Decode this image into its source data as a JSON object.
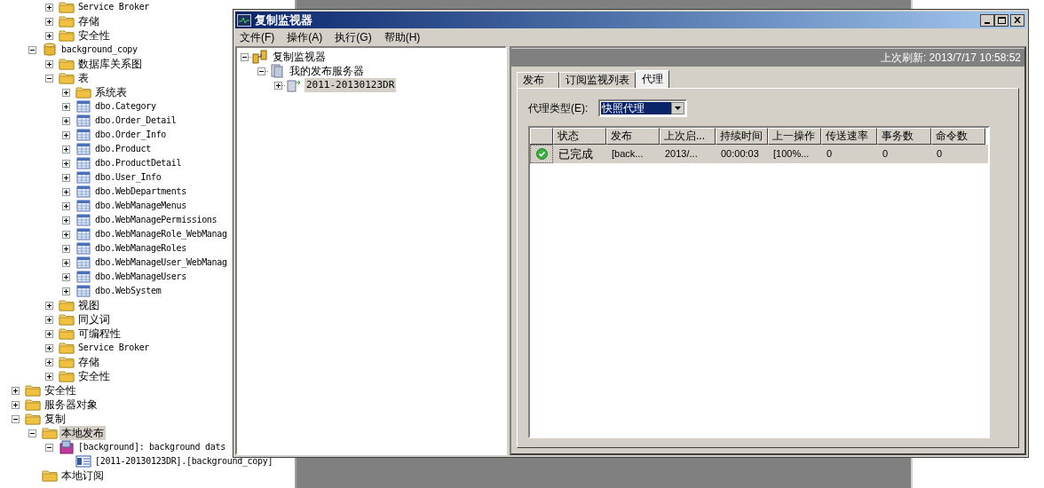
{
  "object_explorer": {
    "continued_items": [
      {
        "label": "Service Broker",
        "kind": "folder",
        "expandable": true,
        "expanded": false,
        "selected": false
      },
      {
        "label": "存储",
        "kind": "folder",
        "expandable": true,
        "expanded": false,
        "selected": false
      },
      {
        "label": "安全性",
        "kind": "folder",
        "expandable": true,
        "expanded": false,
        "selected": false
      }
    ],
    "database_items": [
      {
        "label": "background_copy",
        "kind": "database",
        "expanded": true,
        "selected": false,
        "children": [
          {
            "label": "数据库关系图",
            "kind": "folder",
            "expandable": true,
            "expanded": false,
            "selected": false
          },
          {
            "label": "表",
            "kind": "folder",
            "expanded": true,
            "selected": false,
            "children": [
              {
                "label": "系统表",
                "kind": "folder",
                "expandable": true,
                "expanded": false,
                "selected": false
              },
              {
                "label": "dbo.Category",
                "kind": "table",
                "expandable": true,
                "expanded": false,
                "selected": false
              },
              {
                "label": "dbo.Order_Detail",
                "kind": "table",
                "expandable": true,
                "expanded": false,
                "selected": false
              },
              {
                "label": "dbo.Order_Info",
                "kind": "table",
                "expandable": true,
                "expanded": false,
                "selected": false
              },
              {
                "label": "dbo.Product",
                "kind": "table",
                "expandable": true,
                "expanded": false,
                "selected": false
              },
              {
                "label": "dbo.ProductDetail",
                "kind": "table",
                "expandable": true,
                "expanded": false,
                "selected": false
              },
              {
                "label": "dbo.User_Info",
                "kind": "table",
                "expandable": true,
                "expanded": false,
                "selected": false
              },
              {
                "label": "dbo.WebDepartments",
                "kind": "table",
                "expandable": true,
                "expanded": false,
                "selected": false
              },
              {
                "label": "dbo.WebManageMenus",
                "kind": "table",
                "expandable": true,
                "expanded": false,
                "selected": false
              },
              {
                "label": "dbo.WebManagePermissions",
                "kind": "table",
                "expandable": true,
                "expanded": false,
                "selected": false
              },
              {
                "label": "dbo.WebManageRole_WebManag",
                "kind": "table",
                "expandable": true,
                "expanded": false,
                "selected": false
              },
              {
                "label": "dbo.WebManageRoles",
                "kind": "table",
                "expandable": true,
                "expanded": false,
                "selected": false
              },
              {
                "label": "dbo.WebManageUser_WebManag",
                "kind": "table",
                "expandable": true,
                "expanded": false,
                "selected": false
              },
              {
                "label": "dbo.WebManageUsers",
                "kind": "table",
                "expandable": true,
                "expanded": false,
                "selected": false
              },
              {
                "label": "dbo.WebSystem",
                "kind": "table",
                "expandable": true,
                "expanded": false,
                "selected": false
              }
            ]
          },
          {
            "label": "视图",
            "kind": "folder",
            "expandable": true,
            "expanded": false,
            "selected": false
          },
          {
            "label": "同义词",
            "kind": "folder",
            "expandable": true,
            "expanded": false,
            "selected": false
          },
          {
            "label": "可编程性",
            "kind": "folder",
            "expandable": true,
            "expanded": false,
            "selected": false
          },
          {
            "label": "Service Broker",
            "kind": "folder",
            "expandable": true,
            "expanded": false,
            "selected": false
          },
          {
            "label": "存储",
            "kind": "folder",
            "expandable": true,
            "expanded": false,
            "selected": false
          },
          {
            "label": "安全性",
            "kind": "folder",
            "expandable": true,
            "expanded": false,
            "selected": false
          }
        ]
      }
    ],
    "server_items": [
      {
        "label": "安全性",
        "kind": "folder",
        "expandable": true,
        "expanded": false,
        "selected": false
      },
      {
        "label": "服务器对象",
        "kind": "folder",
        "expandable": true,
        "expanded": false,
        "selected": false
      },
      {
        "label": "复制",
        "kind": "folder",
        "expanded": true,
        "selected": false,
        "children": [
          {
            "label": "本地发布",
            "kind": "folder",
            "expanded": true,
            "selected": true,
            "children": [
              {
                "label": "[background]: background dats",
                "kind": "publication",
                "expanded": true,
                "selected": false,
                "children": [
                  {
                    "label": "[2011-20130123DR].[background_copy]",
                    "kind": "subscription",
                    "expandable": false,
                    "expanded": false,
                    "selected": false
                  }
                ]
              }
            ]
          },
          {
            "label": "本地订阅",
            "kind": "folder",
            "expandable": false,
            "expanded": false,
            "selected": false
          }
        ]
      }
    ]
  },
  "window": {
    "title": "复制监视器",
    "menu": [
      "文件(F)",
      "操作(A)",
      "执行(G)",
      "帮助(H)"
    ],
    "tree": [
      {
        "label": "复制监视器",
        "kind": "monitor",
        "expanded": true,
        "selected": false,
        "children": [
          {
            "label": "我的发布服务器",
            "kind": "servers",
            "expanded": true,
            "selected": false,
            "children": [
              {
                "label": "2011-20130123DR",
                "kind": "server",
                "expanded": false,
                "selected": true
              }
            ]
          }
        ]
      }
    ],
    "last_refresh": "上次刷新: 2013/7/17 10:58:52",
    "tabs": [
      {
        "label": "发布",
        "selected": false
      },
      {
        "label": "订阅监视列表",
        "selected": false
      },
      {
        "label": "代理",
        "selected": true
      }
    ],
    "agent_type": {
      "label": "代理类型(E):",
      "value": "快照代理"
    },
    "grid": {
      "columns": [
        "状态",
        "发布",
        "上次启...",
        "持续时间",
        "上一操作",
        "传送速率",
        "事务数",
        "命令数"
      ],
      "rows": [
        {
          "kind": "completed",
          "selected": true,
          "cells": [
            "已完成",
            "[back...",
            "2013/...",
            "00:00:03",
            "[100%...",
            "0",
            "0",
            "0"
          ]
        }
      ]
    }
  }
}
